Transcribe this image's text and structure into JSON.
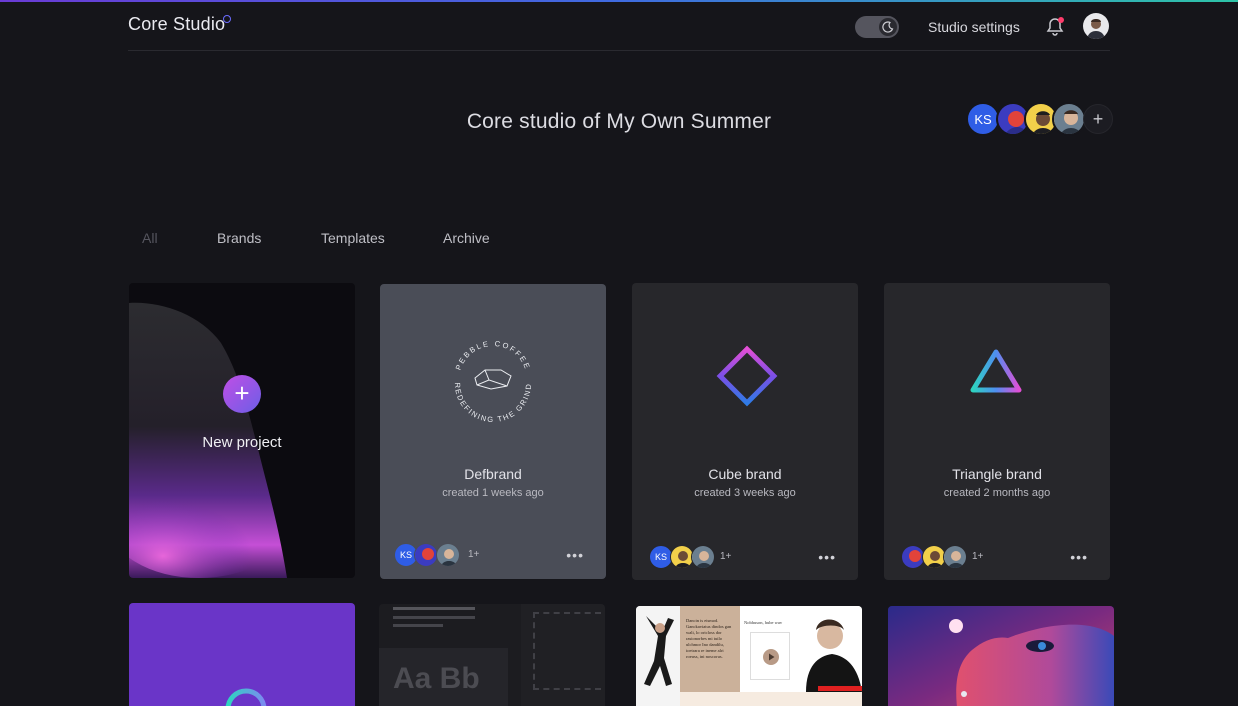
{
  "app": {
    "logo": "Core Studio"
  },
  "header": {
    "settings_label": "Studio settings"
  },
  "studio": {
    "title": "Core studio of My Own Summer",
    "team": [
      {
        "initials": "KS"
      }
    ],
    "add_member": "+"
  },
  "tabs": [
    {
      "label": "All",
      "active": true
    },
    {
      "label": "Brands"
    },
    {
      "label": "Templates"
    },
    {
      "label": "Archive"
    }
  ],
  "new_project": {
    "label": "New project",
    "plus": "+"
  },
  "projects": [
    {
      "name": "Defbrand",
      "created": "created 1 weeks ago",
      "logo_top_text": "PEBBLE COFFEE",
      "logo_bottom_text": "REDEFINING THE GRIND",
      "member_initials": "KS",
      "more": "1+",
      "menu": "•••"
    },
    {
      "name": "Cube brand",
      "created": "created 3 weeks ago",
      "member_initials": "KS",
      "more": "1+",
      "menu": "•••"
    },
    {
      "name": "Triangle brand",
      "created": "created 2 months ago",
      "more": "1+",
      "menu": "•••"
    }
  ],
  "templates": {
    "type_sample": "Aa Bb"
  },
  "preview": {
    "text_block_1": "Dancin is eismod. Ganckaviatus dindos gan wali, lo oricloss dor rasionorbes mi tuilo ulchmor Ino dandilu, ioetrara re ineme alri roeuss, ini noscorus.",
    "text_block_2": "Nobhuson, hube wav"
  },
  "colors": {
    "bg": "#15151a",
    "card": "#27272b",
    "card_selected": "#4a4d57",
    "accent_blue": "#2f5de6"
  }
}
